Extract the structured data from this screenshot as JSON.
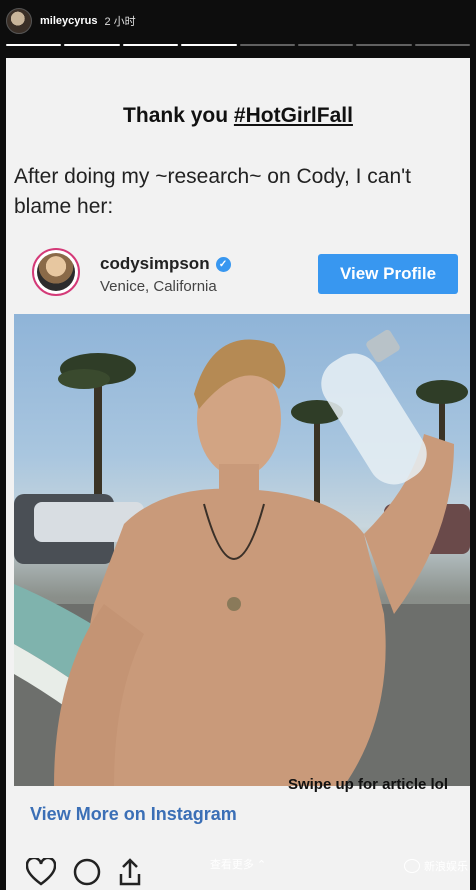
{
  "story": {
    "username": "mileycyrus",
    "time": "2 小时",
    "progress_segments": 8,
    "progress_done": 4
  },
  "post": {
    "title_prefix": "Thank you ",
    "title_tag": "#HotGirlFall",
    "caption": "After doing my ~research~ on Cody, I can't blame her:"
  },
  "instagram_embed": {
    "username": "codysimpson",
    "location": "Venice, California",
    "view_profile_label": "View Profile",
    "view_more_label": "View More on Instagram",
    "verified_glyph": "✓"
  },
  "overlay": {
    "swipe_text": "Swipe up for article lol",
    "more_link": "查看更多 ⌃",
    "watermark": "新浪娱乐"
  },
  "colors": {
    "accent": "#3897f0",
    "link": "#3b6fb6"
  }
}
